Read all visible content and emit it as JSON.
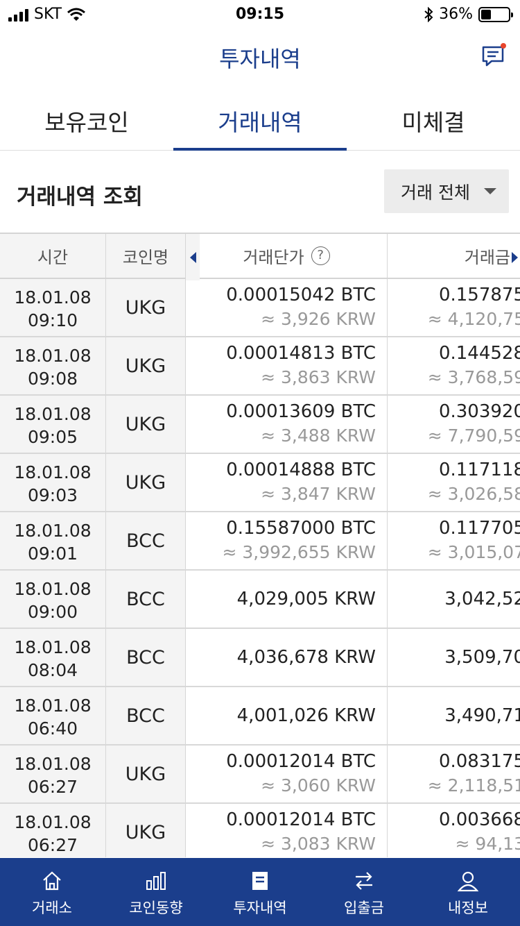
{
  "status_bar": {
    "carrier": "SKT",
    "time": "09:15",
    "battery": "36%",
    "battery_level": 0.36
  },
  "header": {
    "title": "투자내역",
    "chat_icon": "chat-bubble-icon",
    "notification_dot_color": "#e8452c"
  },
  "tabs": [
    {
      "label": "보유코인",
      "active": false
    },
    {
      "label": "거래내역",
      "active": true
    },
    {
      "label": "미체결",
      "active": false
    }
  ],
  "section": {
    "title": "거래내역 조회",
    "filter_label": "거래 전체"
  },
  "table": {
    "columns": {
      "time": "시간",
      "coin": "코인명",
      "price": "거래단가",
      "amount": "거래금"
    },
    "rows": [
      {
        "date": "18.01.08",
        "time": "09:10",
        "coin": "UKG",
        "price": "0.00015042 BTC",
        "price_sub": "≈ 3,926 KRW",
        "amount": "0.157875",
        "amount_sub": "≈ 4,120,75"
      },
      {
        "date": "18.01.08",
        "time": "09:08",
        "coin": "UKG",
        "price": "0.00014813 BTC",
        "price_sub": "≈ 3,863 KRW",
        "amount": "0.144528",
        "amount_sub": "≈ 3,768,59"
      },
      {
        "date": "18.01.08",
        "time": "09:05",
        "coin": "UKG",
        "price": "0.00013609 BTC",
        "price_sub": "≈ 3,488 KRW",
        "amount": "0.303920",
        "amount_sub": "≈ 7,790,59"
      },
      {
        "date": "18.01.08",
        "time": "09:03",
        "coin": "UKG",
        "price": "0.00014888 BTC",
        "price_sub": "≈ 3,847 KRW",
        "amount": "0.117118",
        "amount_sub": "≈ 3,026,58"
      },
      {
        "date": "18.01.08",
        "time": "09:01",
        "coin": "BCC",
        "price": "0.15587000 BTC",
        "price_sub": "≈ 3,992,655 KRW",
        "amount": "0.117705",
        "amount_sub": "≈ 3,015,07"
      },
      {
        "date": "18.01.08",
        "time": "09:00",
        "coin": "BCC",
        "price": "4,029,005 KRW",
        "price_sub": "",
        "amount": "3,042,52",
        "amount_sub": ""
      },
      {
        "date": "18.01.08",
        "time": "08:04",
        "coin": "BCC",
        "price": "4,036,678 KRW",
        "price_sub": "",
        "amount": "3,509,70",
        "amount_sub": ""
      },
      {
        "date": "18.01.08",
        "time": "06:40",
        "coin": "BCC",
        "price": "4,001,026 KRW",
        "price_sub": "",
        "amount": "3,490,71",
        "amount_sub": ""
      },
      {
        "date": "18.01.08",
        "time": "06:27",
        "coin": "UKG",
        "price": "0.00012014 BTC",
        "price_sub": "≈ 3,060 KRW",
        "amount": "0.083175",
        "amount_sub": "≈ 2,118,51"
      },
      {
        "date": "18.01.08",
        "time": "06:27",
        "coin": "UKG",
        "price": "0.00012014 BTC",
        "price_sub": "≈ 3,083 KRW",
        "amount": "0.003668",
        "amount_sub": "≈ 94,13"
      }
    ]
  },
  "bottom_nav": [
    {
      "label": "거래소",
      "icon": "home-icon"
    },
    {
      "label": "코인동향",
      "icon": "bar-chart-icon"
    },
    {
      "label": "투자내역",
      "icon": "document-icon"
    },
    {
      "label": "입출금",
      "icon": "transfer-icon"
    },
    {
      "label": "내정보",
      "icon": "user-icon"
    }
  ],
  "colors": {
    "brand": "#1b3e8c",
    "muted_text": "#999999",
    "header_bg": "#f4f4f4"
  }
}
